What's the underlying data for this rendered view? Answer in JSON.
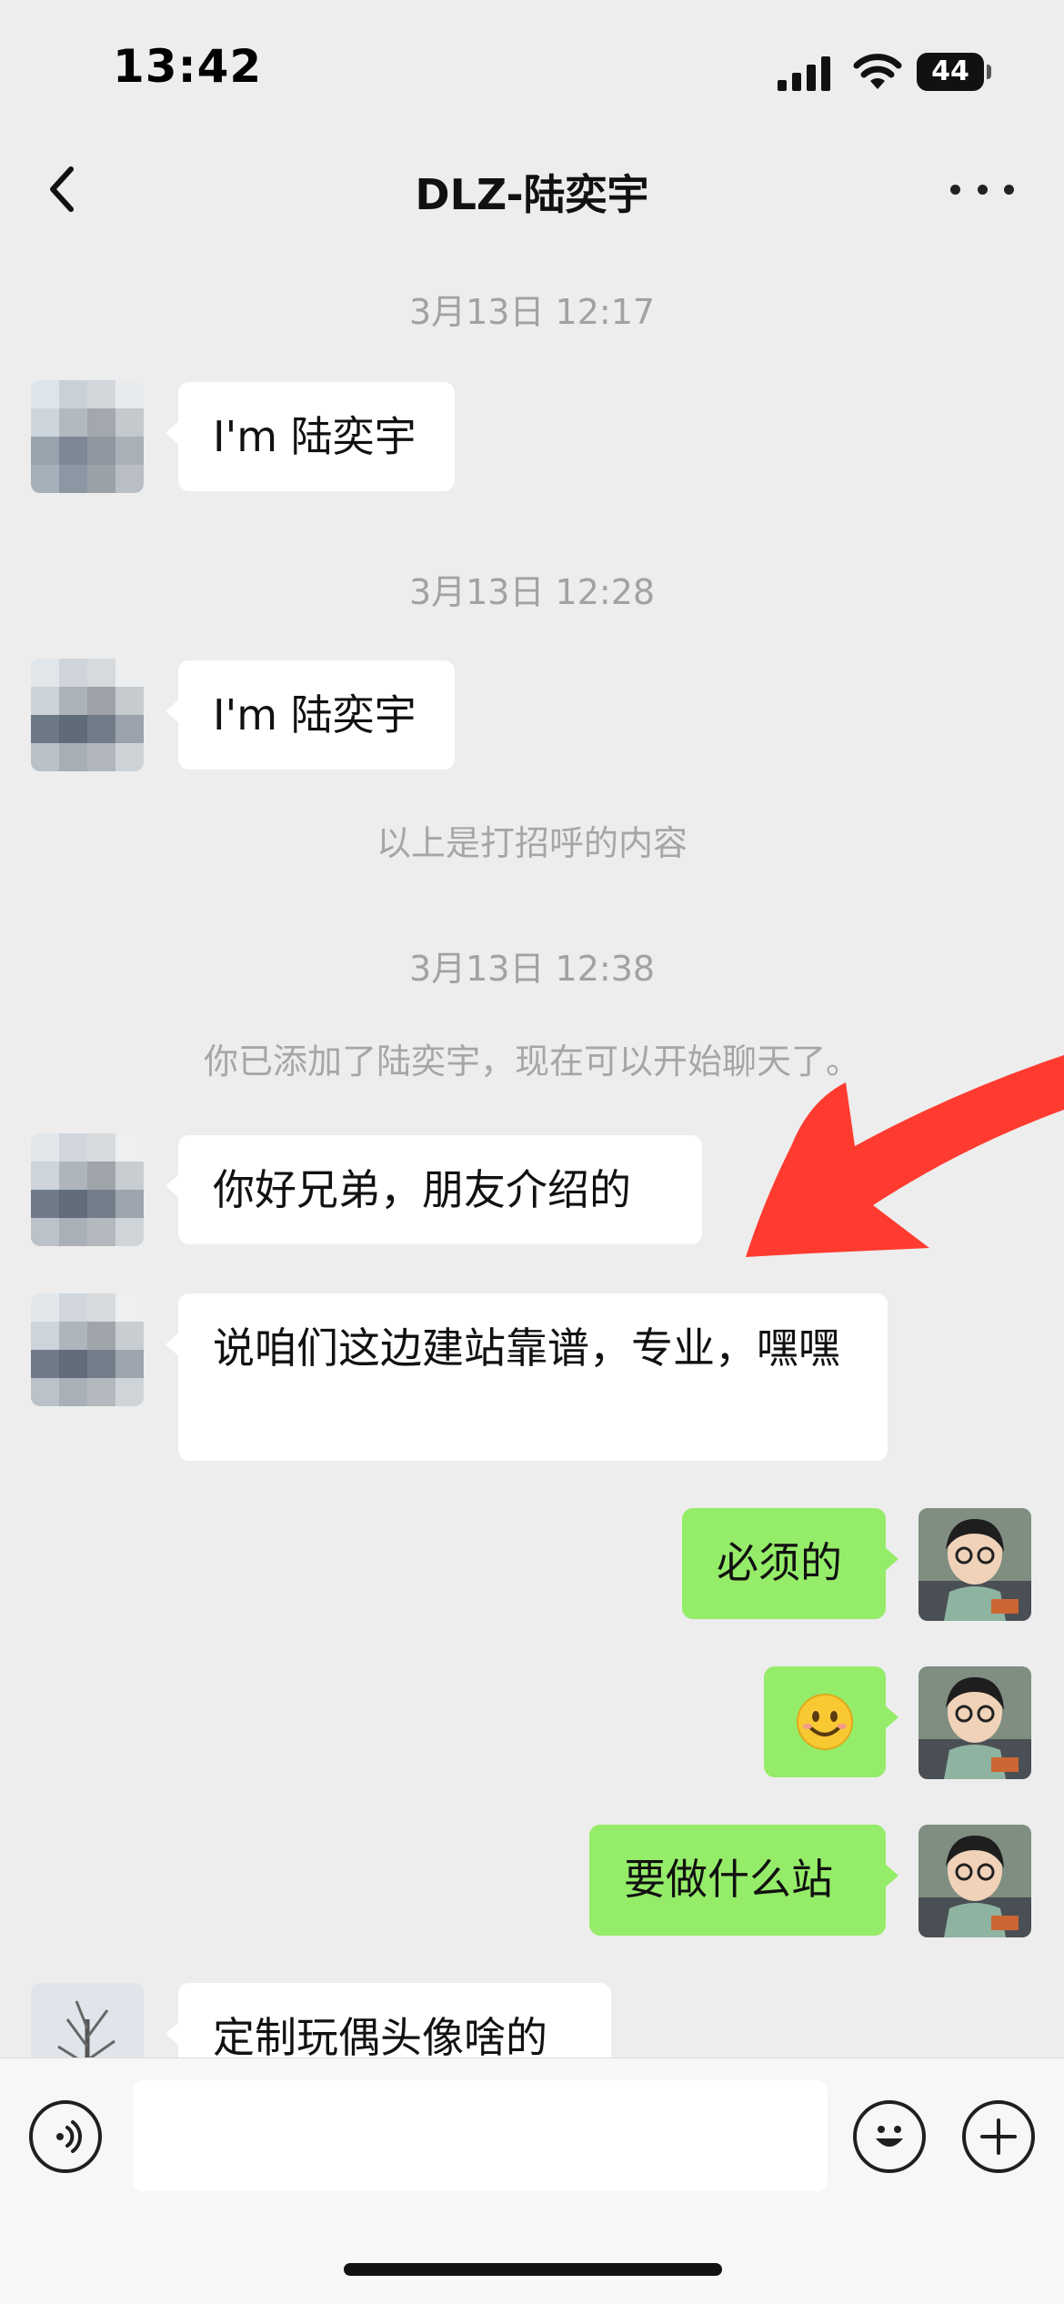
{
  "status_bar": {
    "time": "13:42",
    "battery": "44"
  },
  "header": {
    "title": "DLZ-陆奕宇"
  },
  "timestamps": [
    "3月13日 12:17",
    "3月13日 12:28",
    "3月13日 12:38"
  ],
  "system_notes": {
    "greeting_note": "以上是打招呼的内容",
    "added_note": "你已添加了陆奕宇，现在可以开始聊天了。"
  },
  "messages": [
    {
      "side": "in",
      "text": "I'm 陆奕宇"
    },
    {
      "side": "in",
      "text": "I'm 陆奕宇"
    },
    {
      "side": "in",
      "text": "你好兄弟，朋友介绍的"
    },
    {
      "side": "in",
      "text": "说咱们这边建站靠谱，专业，嘿嘿"
    },
    {
      "side": "out",
      "text": "必须的"
    },
    {
      "side": "out",
      "text": "",
      "sticker": "smiling-emoji"
    },
    {
      "side": "out",
      "text": "要做什么站"
    },
    {
      "side": "in",
      "text": "定制玩偶头像啥的"
    }
  ],
  "colors": {
    "incoming_bubble": "#ffffff",
    "outgoing_bubble": "#95ec69",
    "background": "#ededed",
    "annotation_arrow": "#ff3b30"
  },
  "icons": [
    "back-icon",
    "more-icon",
    "voice-icon",
    "emoji-icon",
    "plus-icon",
    "signal-icon",
    "wifi-icon",
    "battery-icon"
  ]
}
